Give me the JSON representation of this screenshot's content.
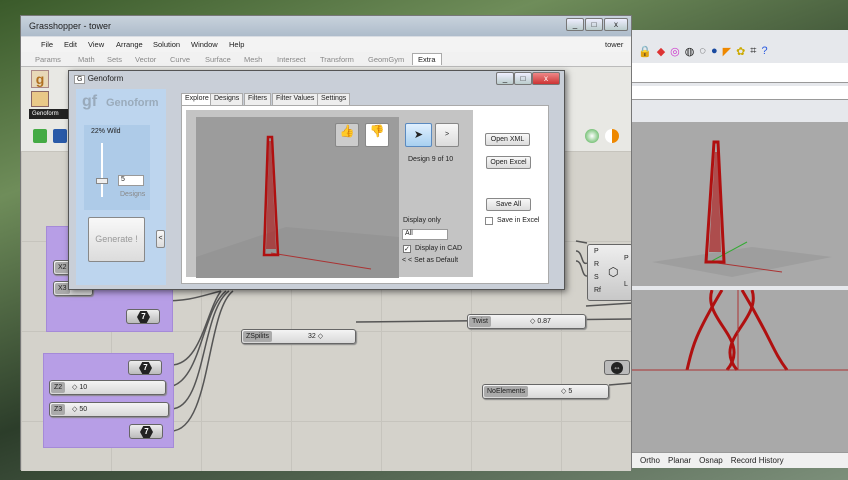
{
  "grasshopper": {
    "title": "Grasshopper - tower",
    "menus": [
      "File",
      "Edit",
      "View",
      "Arrange",
      "Solution",
      "Window",
      "Help"
    ],
    "doc_name": "tower",
    "tabs": [
      "Params",
      "Math",
      "Sets",
      "Vector",
      "Curve",
      "Surface",
      "Mesh",
      "Intersect",
      "Transform",
      "GeomGym",
      "Extra"
    ],
    "active_tab": "Extra",
    "toolbar_group_label": "Genoform",
    "canvas": {
      "inputs_group1": [
        "X2",
        "X3"
      ],
      "number_value": "7",
      "z2": {
        "label": "Z2",
        "value": "◇ 10"
      },
      "z3": {
        "label": "Z3",
        "value": "◇ 50"
      },
      "zsplits": {
        "label": "ZSpilits",
        "value": "32 ◇"
      },
      "twist": {
        "label": "Twist",
        "value": "◇ 0.87"
      },
      "noelements": {
        "label": "NoElements",
        "value": "◇ 5"
      },
      "component_inputs": [
        "P",
        "R",
        "S",
        "Rf"
      ],
      "component_outputs": [
        "P",
        "L"
      ]
    }
  },
  "genoform": {
    "title": "Genoform",
    "logo": "Genoform",
    "wildness": "22%  Wild",
    "designs_count": "5",
    "designs_label": "Designs",
    "generate_label": "Generate !",
    "collapse_label": "<",
    "tabs": [
      "Explore",
      "Designs",
      "Filters",
      "Filter Values",
      "Settings"
    ],
    "next_label": ">",
    "design_status": "Design  9 of 10",
    "display_only_label": "Display only",
    "display_only_value": "All",
    "display_in_cad_label": "Display in CAD",
    "display_in_cad_checked": true,
    "set_default_label": "< < Set as Default",
    "open_xml": "Open XML",
    "open_excel": "Open Excel",
    "save_all": "Save All",
    "save_in_excel_label": "Save in Excel",
    "save_in_excel_checked": false
  },
  "rhino": {
    "status_items": [
      "Ortho",
      "Planar",
      "Osnap",
      "Record History"
    ]
  },
  "colors": {
    "tower": "#b01010",
    "group": "#b79ee6",
    "genoform_panel": "#bdd5ee"
  }
}
